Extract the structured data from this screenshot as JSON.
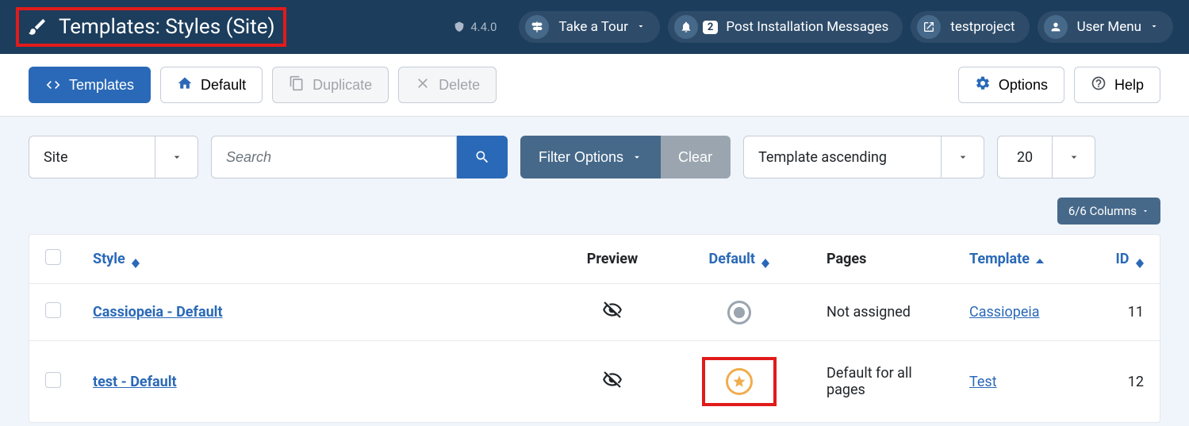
{
  "header": {
    "title": "Templates: Styles (Site)",
    "version": "4.4.0",
    "tour_label": "Take a Tour",
    "notif_count": "2",
    "post_install_label": "Post Installation Messages",
    "project_name": "testproject",
    "user_menu_label": "User Menu"
  },
  "toolbar": {
    "templates": "Templates",
    "default": "Default",
    "duplicate": "Duplicate",
    "delete": "Delete",
    "options": "Options",
    "help": "Help"
  },
  "filters": {
    "client": "Site",
    "search_placeholder": "Search",
    "filter_options": "Filter Options",
    "clear": "Clear",
    "sort": "Template ascending",
    "limit": "20",
    "columns": "6/6 Columns"
  },
  "table": {
    "headers": {
      "style": "Style",
      "preview": "Preview",
      "default": "Default",
      "pages": "Pages",
      "template": "Template",
      "id": "ID"
    },
    "rows": [
      {
        "style": "Cassiopeia - Default",
        "pages": "Not assigned",
        "template": "Cassiopeia",
        "id": "11",
        "is_default": false
      },
      {
        "style": "test - Default",
        "pages": "Default for all pages",
        "template": "Test",
        "id": "12",
        "is_default": true
      }
    ]
  }
}
